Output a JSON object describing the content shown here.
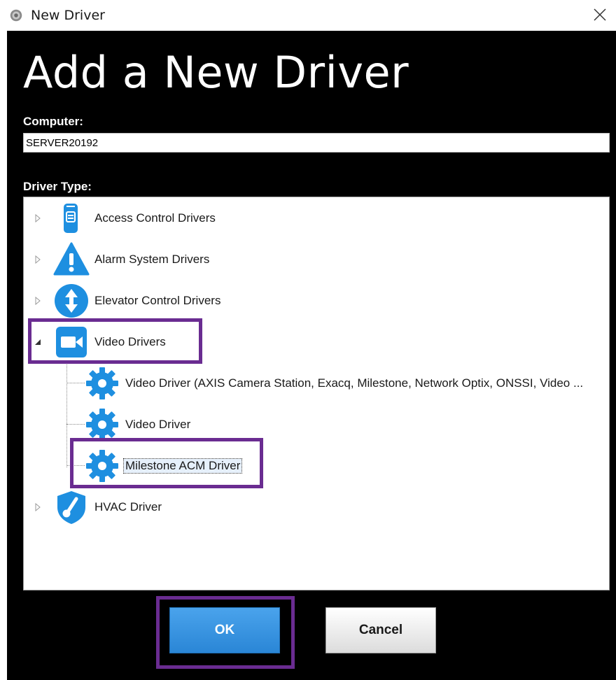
{
  "window": {
    "title": "New Driver"
  },
  "heading": "Add a New Driver",
  "computer": {
    "label": "Computer:",
    "value": "SERVER20192"
  },
  "driver_type": {
    "label": "Driver Type:"
  },
  "tree": {
    "access_control": "Access Control Drivers",
    "alarm_system": "Alarm System Drivers",
    "elevator_control": "Elevator Control Drivers",
    "video": "Video Drivers",
    "video_children": [
      "Video Driver (AXIS Camera Station, Exacq, Milestone, Network Optix, ONSSI, Video ...",
      "Video Driver",
      "Milestone ACM Driver"
    ],
    "hvac": "HVAC Driver",
    "selected": "Milestone ACM Driver"
  },
  "buttons": {
    "ok": "OK",
    "cancel": "Cancel"
  },
  "colors": {
    "icon_blue": "#1e8fe0",
    "highlight": "#6a2c91",
    "ok_blue": "#2a86d6"
  }
}
